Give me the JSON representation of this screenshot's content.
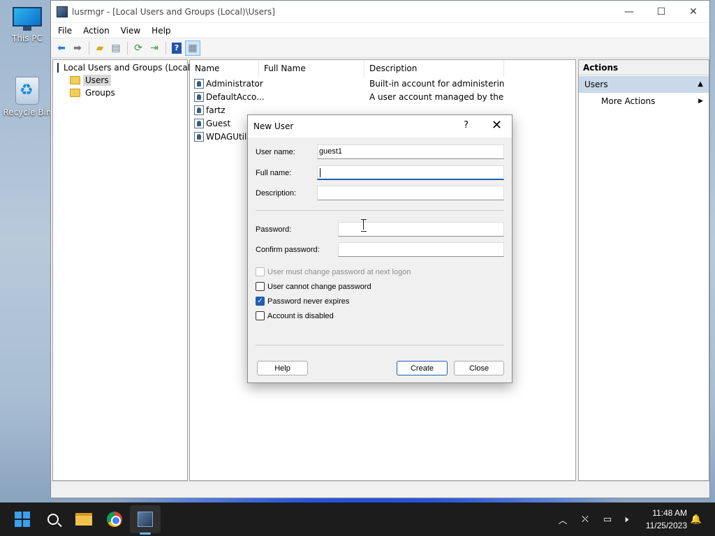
{
  "desktop": {
    "icons": [
      {
        "label": "This PC"
      },
      {
        "label": "Recycle Bin"
      }
    ]
  },
  "window": {
    "title": "lusrmgr - [Local Users and Groups (Local)\\Users]",
    "menu": [
      "File",
      "Action",
      "View",
      "Help"
    ]
  },
  "tree": {
    "root": "Local Users and Groups (Local)",
    "children": [
      "Users",
      "Groups"
    ],
    "selected": "Users"
  },
  "list": {
    "columns": [
      "Name",
      "Full Name",
      "Description"
    ],
    "rows": [
      {
        "name": "Administrator",
        "full_name": "",
        "description": "Built-in account for administering..."
      },
      {
        "name": "DefaultAcco...",
        "full_name": "",
        "description": "A user account managed by the s..."
      },
      {
        "name": "fartz",
        "full_name": "",
        "description": ""
      },
      {
        "name": "Guest",
        "full_name": "",
        "description": ""
      },
      {
        "name": "WDAGUtilit",
        "full_name": "",
        "description": ""
      }
    ]
  },
  "actions": {
    "header": "Actions",
    "section": "Users",
    "items": [
      "More Actions"
    ]
  },
  "dialog": {
    "title": "New User",
    "help_glyph": "?",
    "close_glyph": "✕",
    "user_name_label": "User name:",
    "user_name_value": "guest1",
    "full_name_label": "Full name:",
    "full_name_value": "",
    "description_label": "Description:",
    "description_value": "",
    "password_label": "Password:",
    "confirm_label": "Confirm password:",
    "checkboxes": [
      {
        "label": "User must change password at next logon",
        "checked": false,
        "disabled": true
      },
      {
        "label": "User cannot change password",
        "checked": false,
        "disabled": false
      },
      {
        "label": "Password never expires",
        "checked": true,
        "disabled": false
      },
      {
        "label": "Account is disabled",
        "checked": false,
        "disabled": false
      }
    ],
    "help_button": "Help",
    "create_button": "Create",
    "close_button": "Close"
  },
  "taskbar": {
    "time": "11:48 AM",
    "date": "11/25/2023"
  },
  "colors": {
    "accent": "#1f5fae",
    "selection": "#c9d9ea"
  }
}
